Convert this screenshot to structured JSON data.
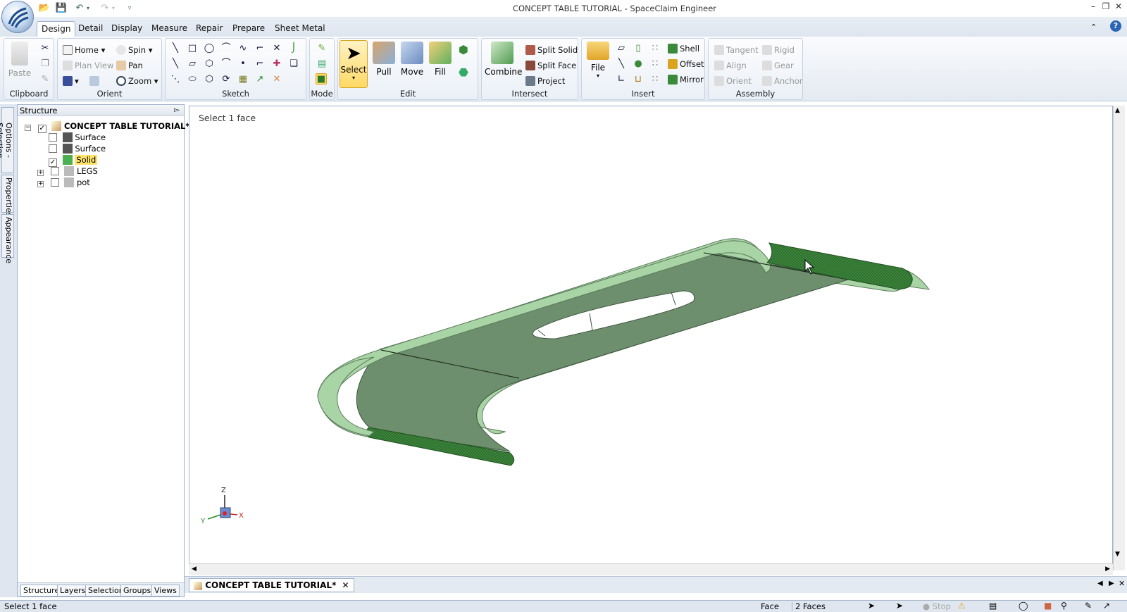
{
  "window": {
    "title": "CONCEPT TABLE TUTORIAL - SpaceClaim Engineer"
  },
  "menu_tabs": [
    "Design",
    "Detail",
    "Display",
    "Measure",
    "Repair",
    "Prepare",
    "Sheet Metal"
  ],
  "ribbon": {
    "clipboard": {
      "label": "Clipboard",
      "paste": "Paste"
    },
    "orient": {
      "label": "Orient",
      "home": "Home",
      "spin": "Spin",
      "plan_view": "Plan View",
      "pan": "Pan",
      "zoom": "Zoom"
    },
    "sketch": {
      "label": "Sketch"
    },
    "mode": {
      "label": "Mode"
    },
    "edit": {
      "label": "Edit",
      "select": "Select",
      "pull": "Pull",
      "move": "Move",
      "fill": "Fill"
    },
    "intersect": {
      "label": "Intersect",
      "combine": "Combine",
      "split_solid": "Split Solid",
      "split_face": "Split Face",
      "project": "Project"
    },
    "insert": {
      "label": "Insert",
      "file": "File",
      "shell": "Shell",
      "offset": "Offset",
      "mirror": "Mirror"
    },
    "assembly": {
      "label": "Assembly",
      "tangent": "Tangent",
      "align": "Align",
      "orient": "Orient",
      "rigid": "Rigid",
      "gear": "Gear",
      "anchor": "Anchor"
    }
  },
  "side_tabs": [
    "Options - Selection",
    "Properties",
    "Appearance"
  ],
  "structure": {
    "title": "Structure",
    "root": "CONCEPT TABLE TUTORIAL*",
    "items": [
      {
        "label": "Surface",
        "checked": false
      },
      {
        "label": "Surface",
        "checked": false
      },
      {
        "label": "Solid",
        "checked": true
      },
      {
        "label": "LEGS",
        "checked": false
      },
      {
        "label": "pot",
        "checked": false
      }
    ],
    "bottom_tabs": [
      "Structure",
      "Layers",
      "Selection",
      "Groups",
      "Views"
    ]
  },
  "viewport": {
    "prompt": "Select 1 face",
    "axes": {
      "z": "Z",
      "y": "Y",
      "x": "X"
    }
  },
  "doc_tab": "CONCEPT TABLE TUTORIAL*",
  "status": {
    "message": "Select 1 face",
    "mode": "Face",
    "selection": "2 Faces",
    "stop": "Stop"
  },
  "colors": {
    "model_light": "#a9d5a6",
    "model_dark": "#6e8f6e",
    "selected_face": "#3f8a3f",
    "ribbon_accent": "#ffd966"
  }
}
